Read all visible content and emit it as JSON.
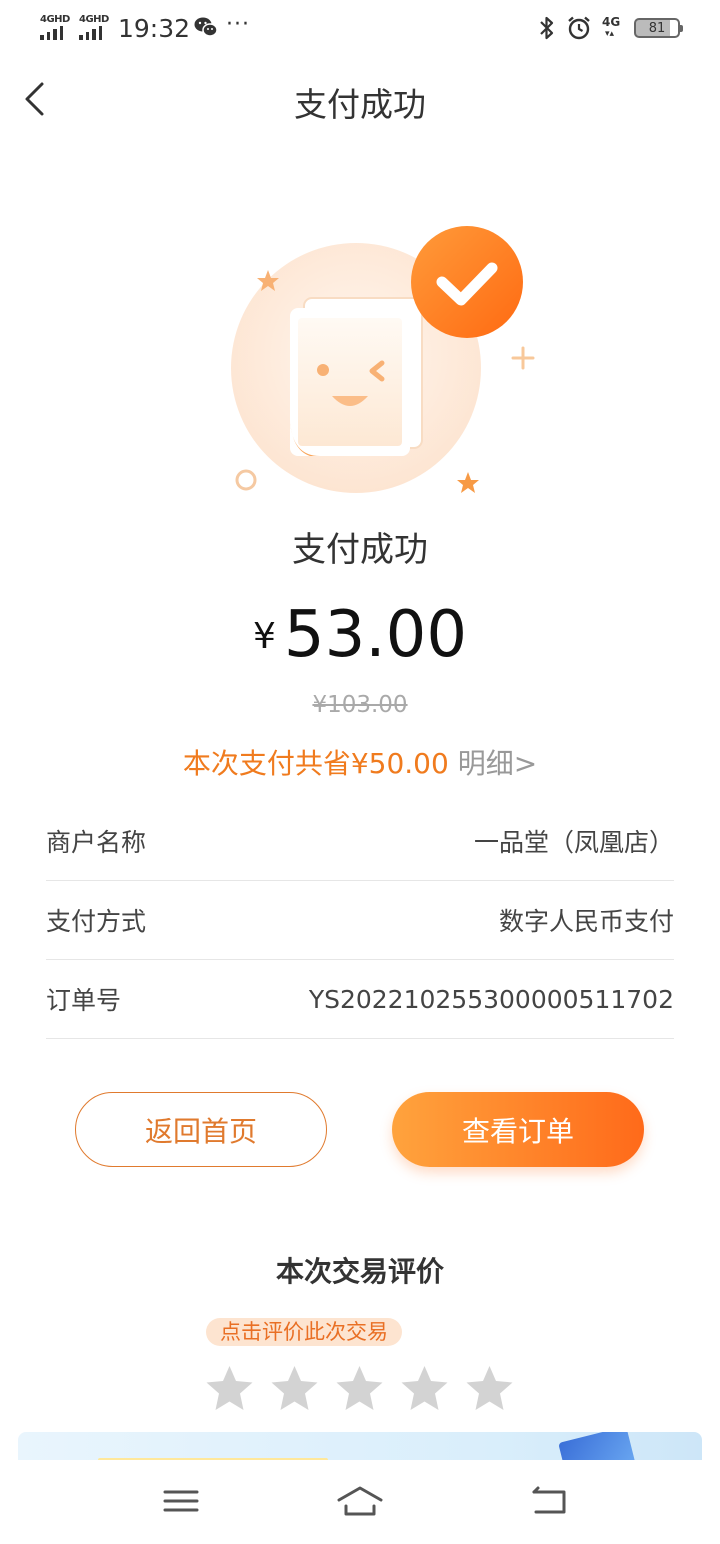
{
  "status_bar": {
    "network_1": "4GHD",
    "network_2": "4GHD",
    "time": "19:32",
    "dots": "···",
    "mobile_data": "4G",
    "battery": "81"
  },
  "nav": {
    "title": "支付成功"
  },
  "result": {
    "title": "支付成功",
    "currency_symbol": "¥",
    "amount": "53.00",
    "original_price": "¥103.00",
    "saving_text": "本次支付共省¥50.00",
    "detail_link": " 明细>"
  },
  "info_rows": [
    {
      "label": "商户名称",
      "value": "一品堂（凤凰店）"
    },
    {
      "label": "支付方式",
      "value": "数字人民币支付"
    },
    {
      "label": "订单号",
      "value": "YS20221025530000051170​2"
    }
  ],
  "buttons": {
    "home": "返回首页",
    "view_order": "查看订单"
  },
  "rating": {
    "title": "本次交易评价",
    "tip": "点击评价此次交易",
    "star_count": 5,
    "selected": 0
  },
  "colors": {
    "accent": "#ff7a22",
    "saving": "#f07b1e",
    "star_inactive": "#d3d3d3"
  },
  "icons": {
    "back": "chevron-left-icon",
    "success": "check-circle-icon",
    "menu": "menu-icon",
    "home": "home-icon",
    "return": "return-icon"
  }
}
